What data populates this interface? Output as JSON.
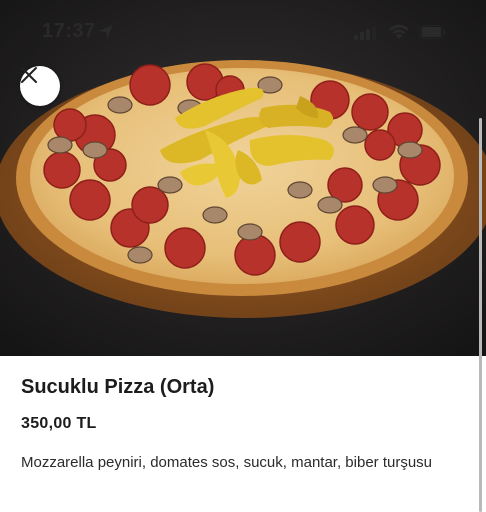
{
  "status_bar": {
    "time": "17:37",
    "icons": [
      "location-arrow-icon",
      "cellular-signal-icon",
      "wifi-icon",
      "battery-icon"
    ]
  },
  "hero": {
    "image": "pepperoni-pizza-photo",
    "close_icon": "close-icon"
  },
  "product": {
    "name": "Sucuklu Pizza (Orta)",
    "price": "350,00 TL",
    "description": "Mozzarella peyniri, domates sos, sucuk, mantar, biber turşusu"
  },
  "colors": {
    "background_dark": "#1e1e1e",
    "crust": "#c98a3e",
    "pepperoni": "#c0392b",
    "pepper": "#e3c22e",
    "text": "#1c1c1c"
  }
}
